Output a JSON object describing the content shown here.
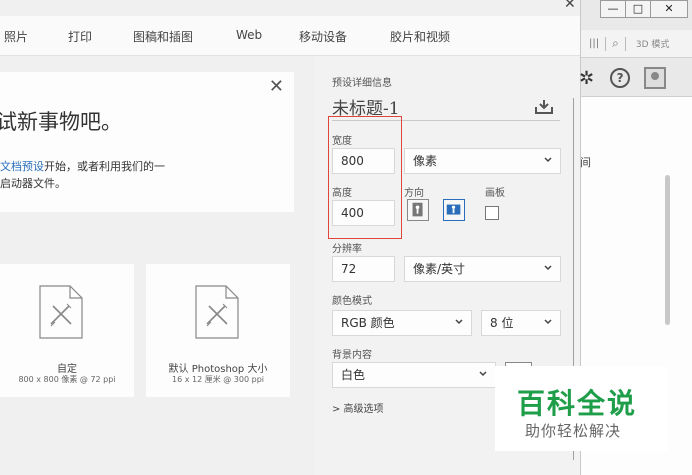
{
  "tabs": [
    {
      "label": "照片"
    },
    {
      "label": "打印"
    },
    {
      "label": "图稿和插图"
    },
    {
      "label": "Web"
    },
    {
      "label": "移动设备"
    },
    {
      "label": "胶片和视频"
    }
  ],
  "welcome": {
    "title": "试新事物吧。",
    "link_text": "文档预设",
    "line1_rest": "开始，或者利用我们的一",
    "line2": "启动器文件。"
  },
  "presets": [
    {
      "name": "自定",
      "size": "800 x 800 像素 @ 72 ppi"
    },
    {
      "name": "默认 Photoshop 大小",
      "size": "16 x 12 厘米 @ 300 ppi"
    }
  ],
  "details": {
    "section_label": "预设详细信息",
    "doc_name": "未标题-1",
    "width_label": "宽度",
    "width_value": "800",
    "width_unit": "像素",
    "height_label": "高度",
    "height_value": "400",
    "orientation_label": "方向",
    "artboard_label": "画板",
    "resolution_label": "分辨率",
    "resolution_value": "72",
    "resolution_unit": "像素/英寸",
    "color_mode_label": "颜色模式",
    "color_mode_value": "RGB 颜色",
    "bit_depth": "8 位",
    "background_label": "背景内容",
    "background_value": "白色",
    "advanced_label": "> 高级选项"
  },
  "background_window": {
    "mode_3d": "3D 模式",
    "fragment": "间"
  },
  "watermark": {
    "main": "百科全说",
    "sub": "助你轻松解决"
  },
  "colors": {
    "accent": "#2a6ebb",
    "highlight": "#e0453a",
    "watermark_green": "#1f9e4a"
  }
}
